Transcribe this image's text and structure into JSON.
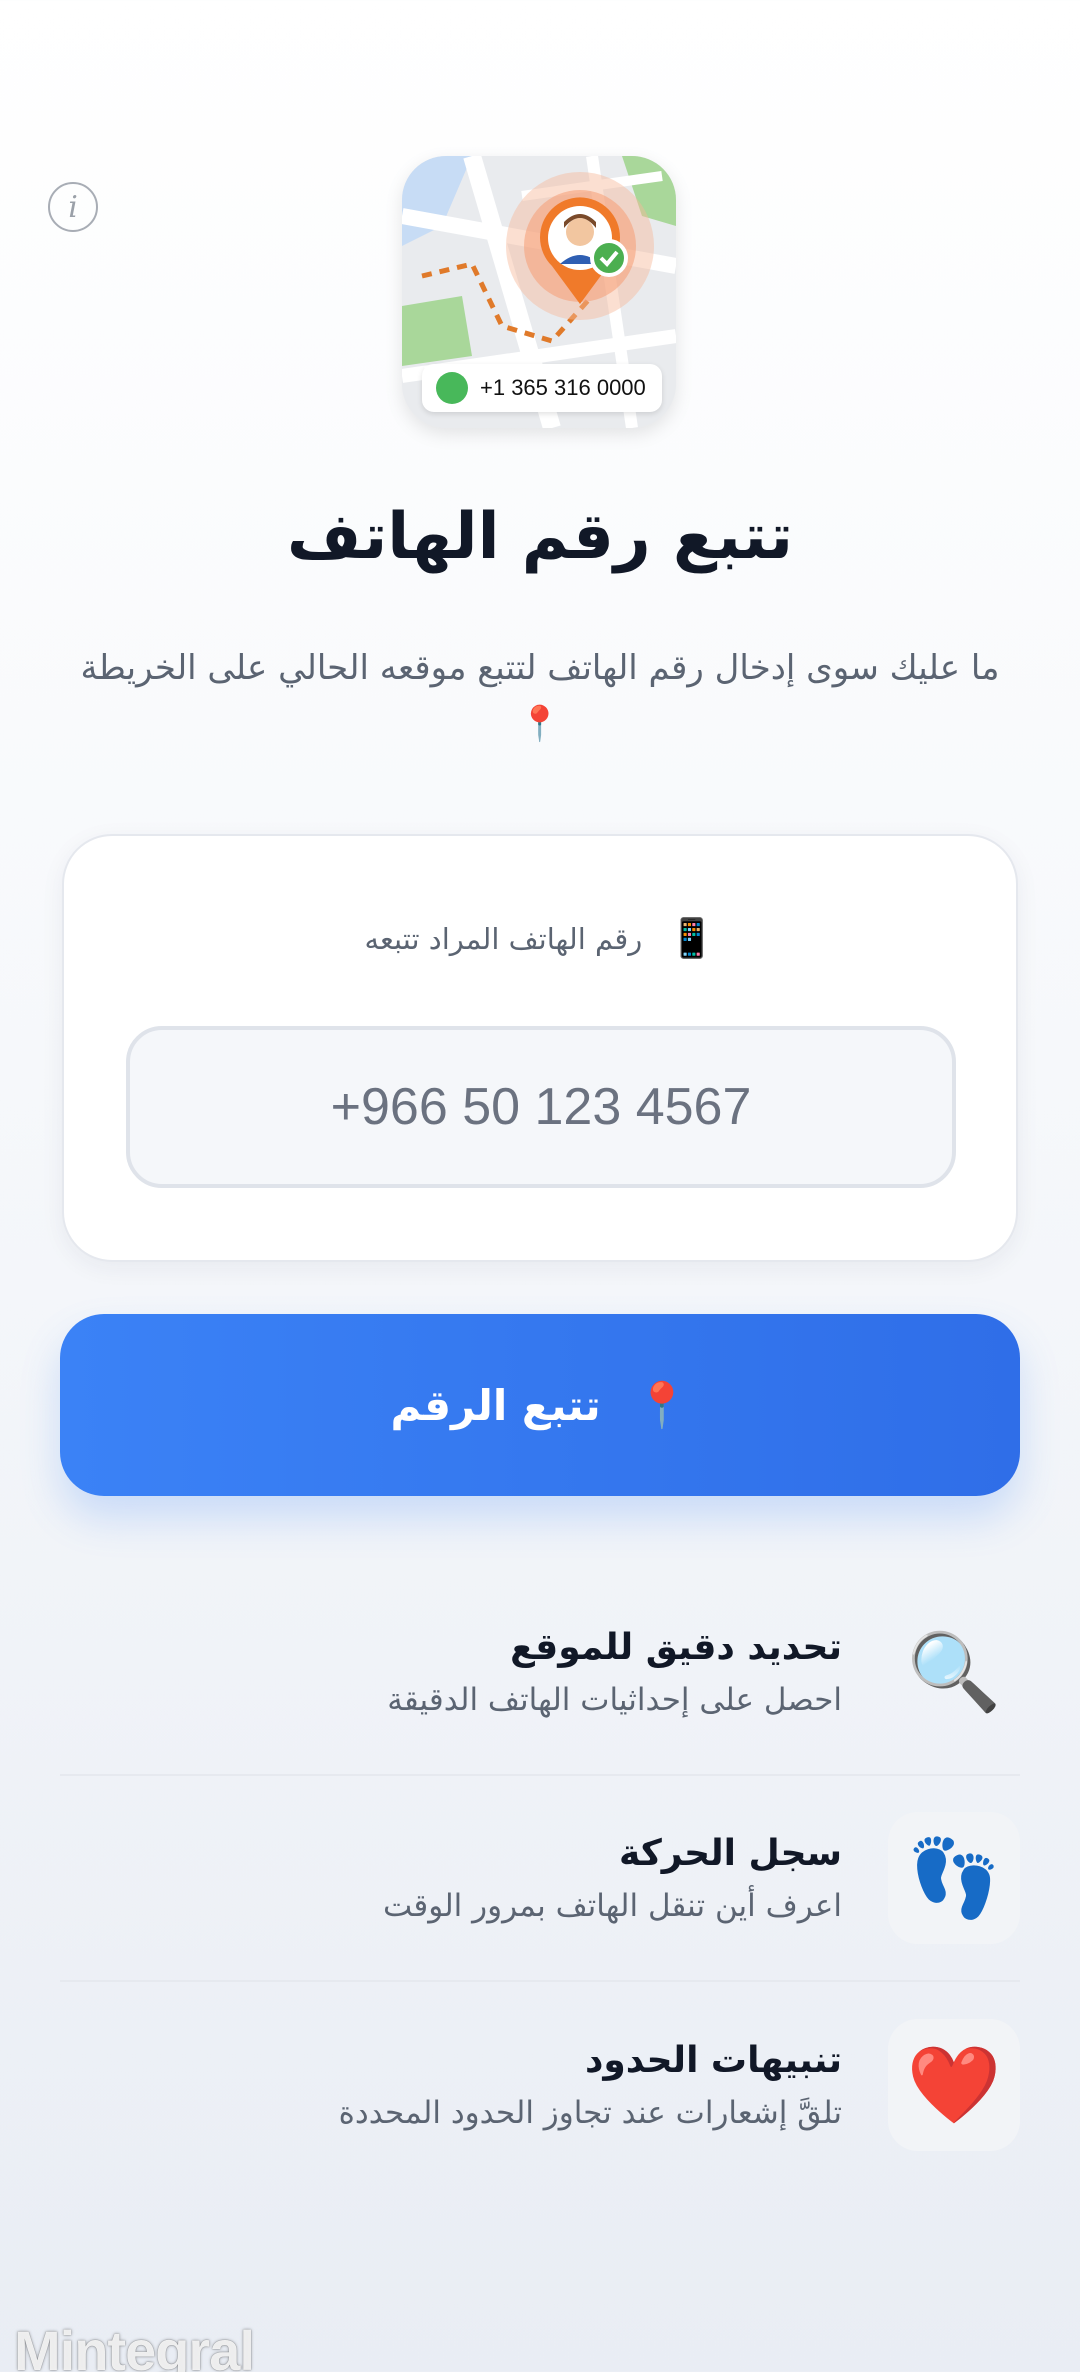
{
  "info_icon": "info-icon",
  "hero": {
    "phone_number": "+1 365 316 0000",
    "icons": [
      "map-icon",
      "location-pin-icon",
      "call-icon",
      "check-icon"
    ]
  },
  "header": {
    "title": "تتبع رقم الهاتف",
    "subtitle": "ما عليك سوى إدخال رقم الهاتف لتتبع موقعه الحالي على الخريطة 📍"
  },
  "form": {
    "label_icon": "📱",
    "label": "رقم الهاتف المراد تتبعه",
    "phone_placeholder": "+966 50 123 4567"
  },
  "track_button": {
    "icon": "📍",
    "label": "تتبع الرقم"
  },
  "features": [
    {
      "icon": "🔍",
      "icon_name": "magnifier-icon",
      "title": "تحديد دقيق للموقع",
      "description": "احصل على إحداثيات الهاتف الدقيقة"
    },
    {
      "icon": "👣",
      "icon_name": "footprints-icon",
      "title": "سجل الحركة",
      "description": "اعرف أين تنقل الهاتف بمرور الوقت"
    },
    {
      "icon": "❤️",
      "icon_name": "heart-icon",
      "title": "تنبيهات الحدود",
      "description": "تلقَّ إشعارات عند تجاوز الحدود المحددة"
    }
  ],
  "watermark": "Mintegral",
  "colors": {
    "primary": "#3b82f6",
    "text_dark": "#111827",
    "text_muted": "#5b6472",
    "pin_orange": "#f07a2a"
  }
}
